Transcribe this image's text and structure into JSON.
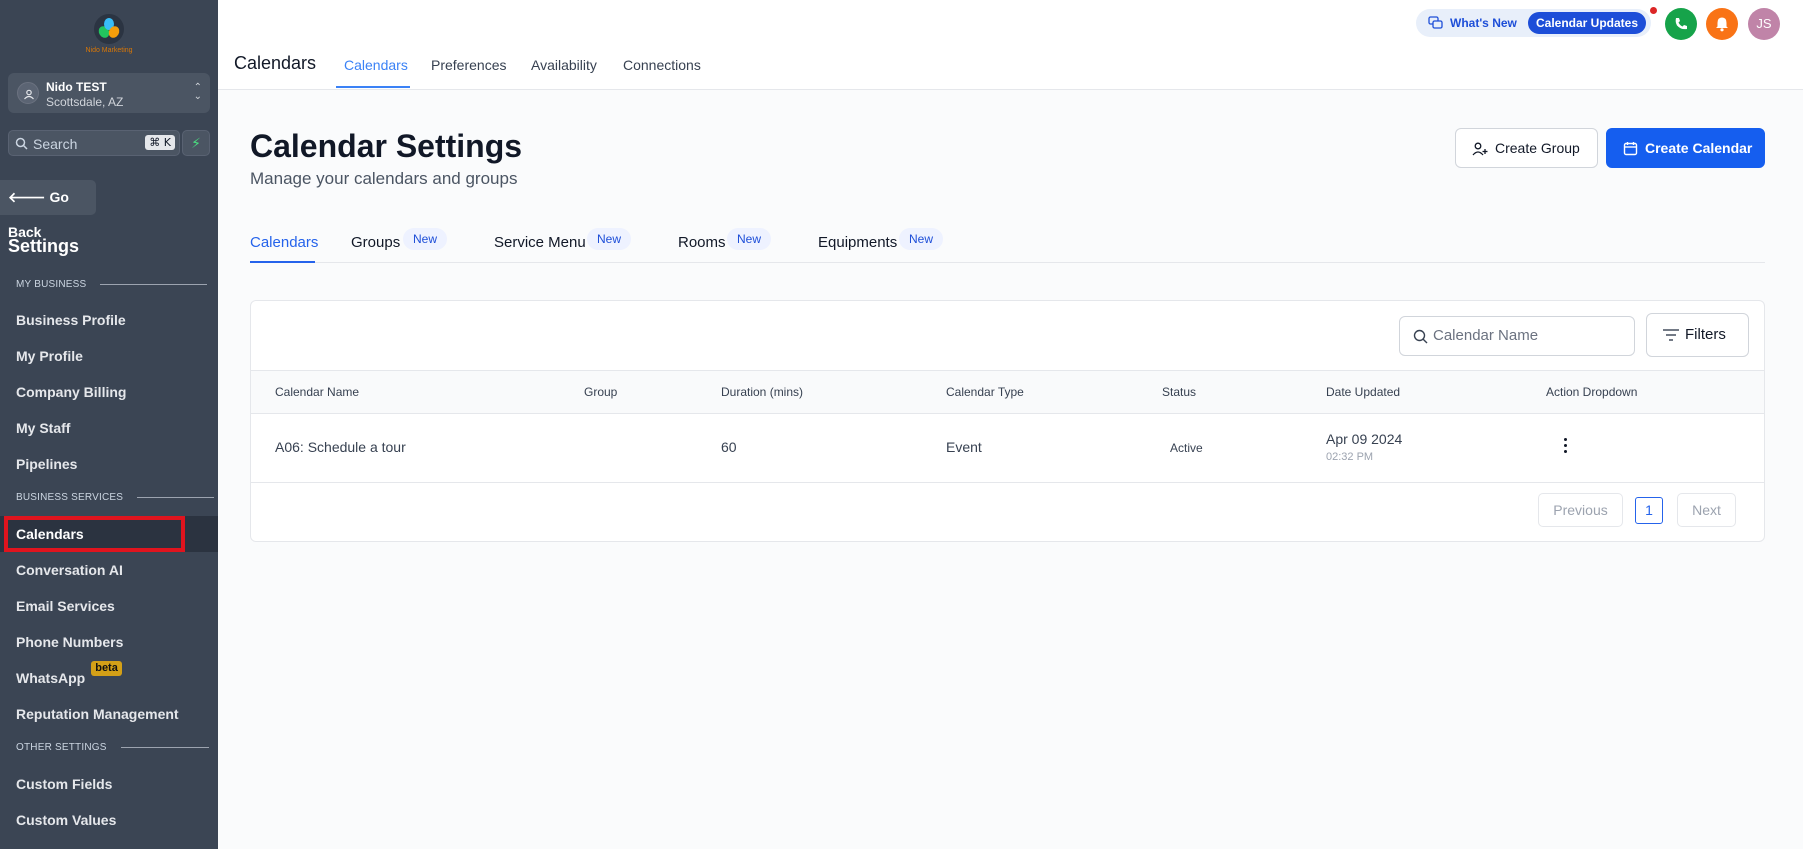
{
  "brand": {
    "logo_text": "Nido Marketing"
  },
  "account": {
    "name": "Nido TEST",
    "location": "Scottsdale, AZ"
  },
  "sidebar": {
    "search_placeholder": "Search",
    "search_shortcut": "⌘ K",
    "go_back": "Go Back",
    "title": "Settings",
    "sections": [
      {
        "label": "MY BUSINESS",
        "items": [
          "Business Profile",
          "My Profile",
          "Company Billing",
          "My Staff",
          "Pipelines"
        ]
      },
      {
        "label": "BUSINESS SERVICES",
        "items": [
          "Calendars",
          "Conversation AI",
          "Email Services",
          "Phone Numbers",
          "WhatsApp",
          "Reputation Management"
        ]
      },
      {
        "label": "OTHER SETTINGS",
        "items": [
          "Custom Fields",
          "Custom Values"
        ]
      }
    ],
    "whatsapp_badge": "beta",
    "active_item": "Calendars"
  },
  "topbar": {
    "title": "Calendars",
    "tabs": [
      "Calendars",
      "Preferences",
      "Availability",
      "Connections"
    ],
    "active_tab": "Calendars",
    "whats_new": "What's New",
    "calendar_updates": "Calendar Updates",
    "avatar_initials": "JS"
  },
  "main": {
    "title": "Calendar Settings",
    "subtitle": "Manage your calendars and groups",
    "create_group": "Create Group",
    "create_calendar": "Create Calendar",
    "tabs": [
      {
        "label": "Calendars",
        "badge": ""
      },
      {
        "label": "Groups",
        "badge": "New"
      },
      {
        "label": "Service Menu",
        "badge": "New"
      },
      {
        "label": "Rooms",
        "badge": "New"
      },
      {
        "label": "Equipments",
        "badge": "New"
      }
    ],
    "search_placeholder": "Calendar Name",
    "filters": "Filters",
    "columns": [
      "Calendar Name",
      "Group",
      "Duration (mins)",
      "Calendar Type",
      "Status",
      "Date Updated",
      "Action Dropdown"
    ],
    "rows": [
      {
        "name": "A06: Schedule a tour",
        "group": "",
        "duration": "60",
        "type": "Event",
        "status": "Active",
        "date": "Apr 09 2024",
        "time": "02:32 PM"
      }
    ],
    "pagination": {
      "previous": "Previous",
      "page": "1",
      "next": "Next"
    }
  },
  "colors": {
    "accent": "#155eef",
    "sidebar_bg": "#3b4554",
    "highlight": "#e0141e"
  }
}
